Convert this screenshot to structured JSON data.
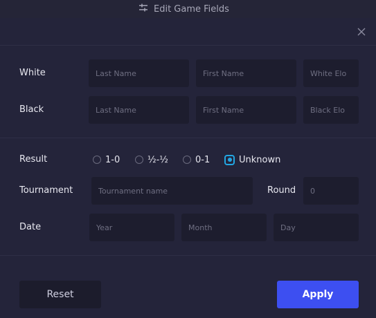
{
  "topbar": {
    "title": "Edit Game Fields",
    "icon": "sliders-icon"
  },
  "dialog": {
    "close_icon": "close-icon"
  },
  "white": {
    "label": "White",
    "last_name_placeholder": "Last Name",
    "first_name_placeholder": "First Name",
    "elo_placeholder": "White Elo"
  },
  "black": {
    "label": "Black",
    "last_name_placeholder": "Last Name",
    "first_name_placeholder": "First Name",
    "elo_placeholder": "Black Elo"
  },
  "result": {
    "label": "Result",
    "options": [
      "1-0",
      "½-½",
      "0-1",
      "Unknown"
    ],
    "selected": "Unknown"
  },
  "tournament": {
    "label": "Tournament",
    "placeholder": "Tournament name",
    "round_label": "Round",
    "round_placeholder": "0"
  },
  "date": {
    "label": "Date",
    "year_placeholder": "Year",
    "month_placeholder": "Month",
    "day_placeholder": "Day"
  },
  "buttons": {
    "reset": "Reset",
    "apply": "Apply"
  },
  "colors": {
    "accent": "#3d4ff1",
    "radio_checked": "#22a7e3",
    "background": "#24243a"
  }
}
